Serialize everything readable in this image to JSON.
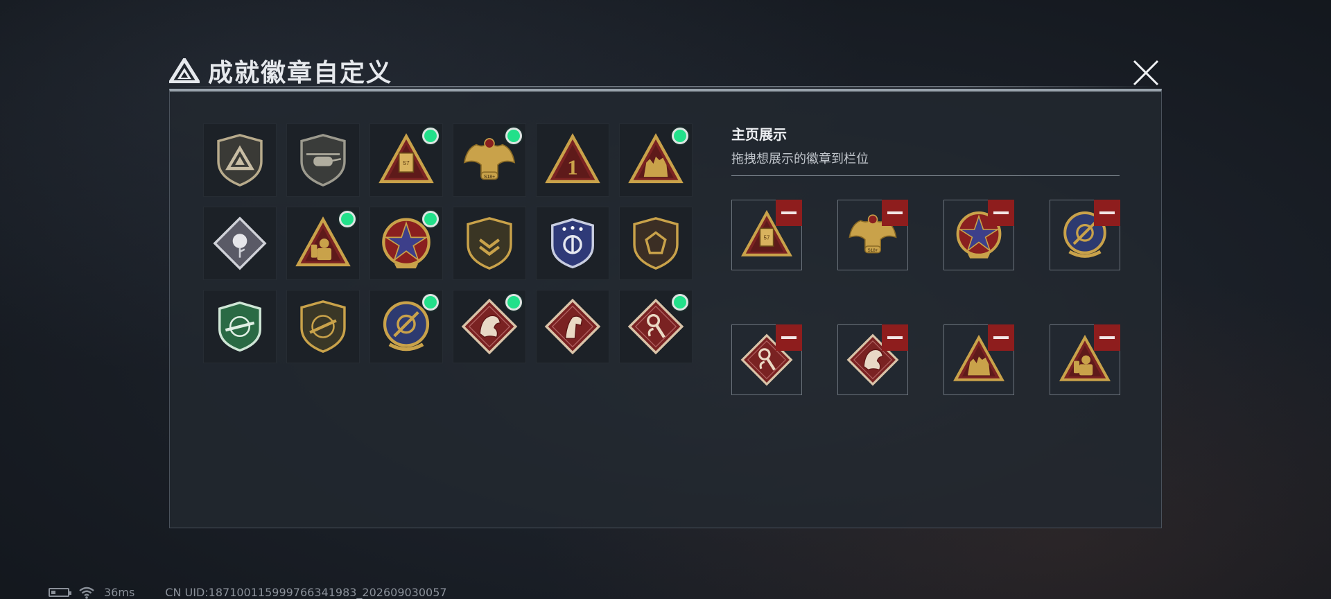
{
  "window": {
    "title": "成就徽章自定义",
    "close_icon": "close-icon"
  },
  "inventory": {
    "badges": [
      {
        "name": "shield-triangle-badge",
        "new": false,
        "style": "shield-grey"
      },
      {
        "name": "helicopter-badge",
        "new": false,
        "style": "shield-heli"
      },
      {
        "name": "crate-57-badge",
        "new": true,
        "style": "tri-crate"
      },
      {
        "name": "eagle-518-badge",
        "new": true,
        "style": "eagle"
      },
      {
        "name": "number-one-badge",
        "new": false,
        "style": "tri-one"
      },
      {
        "name": "soldiers-badge",
        "new": true,
        "style": "tri-soldiers"
      },
      {
        "name": "white-rose-badge",
        "new": false,
        "style": "diamond-rose"
      },
      {
        "name": "hazmat-badge",
        "new": true,
        "style": "tri-hazmat"
      },
      {
        "name": "red-star-badge",
        "new": true,
        "style": "round-star"
      },
      {
        "name": "chevron-shield-badge",
        "new": false,
        "style": "shield-chevron"
      },
      {
        "name": "blue-stars-badge",
        "new": false,
        "style": "shield-blue"
      },
      {
        "name": "gem-shield-badge",
        "new": false,
        "style": "shield-gem"
      },
      {
        "name": "green-crosshair-badge",
        "new": false,
        "style": "shield-green"
      },
      {
        "name": "rifle-crosshair-badge",
        "new": false,
        "style": "shield-rifle"
      },
      {
        "name": "blue-crosshair-badge",
        "new": true,
        "style": "round-blue"
      },
      {
        "name": "red-dragon-badge",
        "new": true,
        "style": "diamond-dragon"
      },
      {
        "name": "red-horse-badge",
        "new": false,
        "style": "diamond-horse"
      },
      {
        "name": "red-wrench-badge",
        "new": true,
        "style": "diamond-wrench"
      }
    ]
  },
  "display": {
    "title": "主页展示",
    "subtitle": "拖拽想展示的徽章到栏位",
    "slots": [
      {
        "name": "crate-57-badge",
        "style": "tri-crate"
      },
      {
        "name": "eagle-518-badge",
        "style": "eagle"
      },
      {
        "name": "red-star-badge",
        "style": "round-star"
      },
      {
        "name": "blue-crosshair-badge",
        "style": "round-blue"
      },
      {
        "name": "red-wrench-badge",
        "style": "diamond-wrench"
      },
      {
        "name": "red-dragon-badge",
        "style": "diamond-dragon"
      },
      {
        "name": "soldiers-badge",
        "style": "tri-soldiers"
      },
      {
        "name": "hazmat-badge",
        "style": "tri-hazmat"
      }
    ],
    "remove_icon": "minus-icon"
  },
  "status_bar": {
    "battery_icon": "battery-icon",
    "wifi_icon": "wifi-icon",
    "ping": "36ms",
    "uid": "CN UID:1871001159997663419​83_202609030057"
  },
  "colors": {
    "gold": "#c9a24a",
    "new_dot": "#22e08a",
    "remove_red": "#8e1d1d",
    "maroon": "#7a2222"
  }
}
